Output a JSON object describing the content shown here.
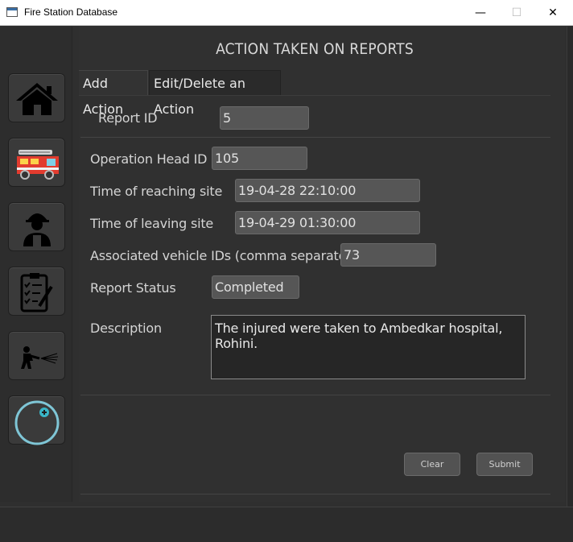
{
  "window": {
    "title": "Fire Station Database",
    "minimize": "—",
    "maximize": "☐",
    "close": "✕"
  },
  "sidebar": {
    "items": [
      {
        "icon": "home-icon"
      },
      {
        "icon": "fire-truck-icon"
      },
      {
        "icon": "firefighter-icon"
      },
      {
        "icon": "clipboard-checklist-icon"
      },
      {
        "icon": "fire-hose-icon"
      },
      {
        "icon": "add-circle-icon"
      }
    ]
  },
  "main": {
    "title": "ACTION TAKEN ON REPORTS",
    "tabs": [
      {
        "label": "Add Action"
      },
      {
        "label": "Edit/Delete an Action"
      }
    ],
    "form": {
      "report_id": {
        "label": "Report ID",
        "value": "5"
      },
      "operation_head_id": {
        "label": "Operation Head ID",
        "value": "105"
      },
      "time_reaching": {
        "label": "Time of reaching site",
        "value": "19-04-28 22:10:00"
      },
      "time_leaving": {
        "label": "Time of leaving site",
        "value": "19-04-29 01:30:00"
      },
      "vehicle_ids": {
        "label": "Associated vehicle IDs (comma separated)",
        "value": "73"
      },
      "report_status": {
        "label": "Report Status",
        "value": "Completed"
      },
      "description": {
        "label": "Description",
        "value": "The injured were taken to Ambedkar hospital, Rohini."
      }
    },
    "buttons": {
      "clear": "Clear",
      "submit": "Submit"
    }
  },
  "colors": {
    "accent": "#3ab6c8",
    "background": "#2f2f2f"
  }
}
